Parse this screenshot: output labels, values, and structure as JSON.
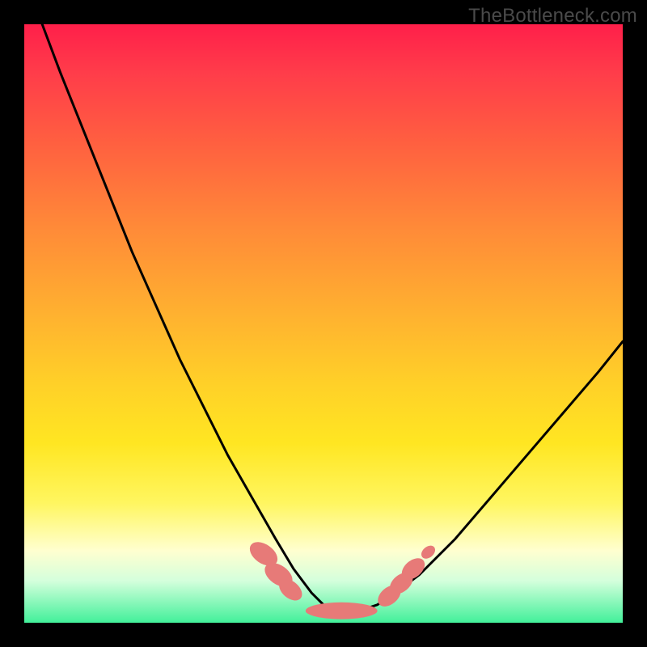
{
  "watermark": "TheBottleneck.com",
  "chart_data": {
    "type": "line",
    "title": "",
    "xlabel": "",
    "ylabel": "",
    "xlim": [
      0,
      100
    ],
    "ylim": [
      0,
      100
    ],
    "series": [
      {
        "name": "bottleneck-curve",
        "x": [
          3,
          6,
          10,
          14,
          18,
          22,
          26,
          30,
          34,
          38,
          42,
          45,
          48,
          50,
          53,
          56,
          59,
          62,
          66,
          72,
          78,
          84,
          90,
          96,
          100
        ],
        "y": [
          100,
          92,
          82,
          72,
          62,
          53,
          44,
          36,
          28,
          21,
          14,
          9,
          5,
          3,
          2,
          2,
          3,
          5,
          8,
          14,
          21,
          28,
          35,
          42,
          47
        ]
      }
    ],
    "markers": [
      {
        "name": "left-cluster-1",
        "cx": 40.0,
        "cy": 11.5,
        "rx": 1.6,
        "ry": 2.6,
        "rot": -55
      },
      {
        "name": "left-cluster-2",
        "cx": 42.5,
        "cy": 8.0,
        "rx": 1.6,
        "ry": 2.6,
        "rot": -55
      },
      {
        "name": "left-cluster-3",
        "cx": 44.5,
        "cy": 5.5,
        "rx": 1.4,
        "ry": 2.2,
        "rot": -50
      },
      {
        "name": "bottom-bar",
        "cx": 53.0,
        "cy": 2.0,
        "rx": 6.0,
        "ry": 1.4,
        "rot": 0
      },
      {
        "name": "right-cluster-1",
        "cx": 61.0,
        "cy": 4.5,
        "rx": 1.4,
        "ry": 2.2,
        "rot": 50
      },
      {
        "name": "right-cluster-2",
        "cx": 63.0,
        "cy": 6.6,
        "rx": 1.4,
        "ry": 2.2,
        "rot": 50
      },
      {
        "name": "right-cluster-3",
        "cx": 65.0,
        "cy": 9.0,
        "rx": 1.4,
        "ry": 2.2,
        "rot": 50
      },
      {
        "name": "right-speck",
        "cx": 67.5,
        "cy": 11.8,
        "rx": 0.9,
        "ry": 1.3,
        "rot": 50
      }
    ],
    "marker_color": "#e77a78",
    "curve_color": "#000000",
    "curve_width": 3
  }
}
